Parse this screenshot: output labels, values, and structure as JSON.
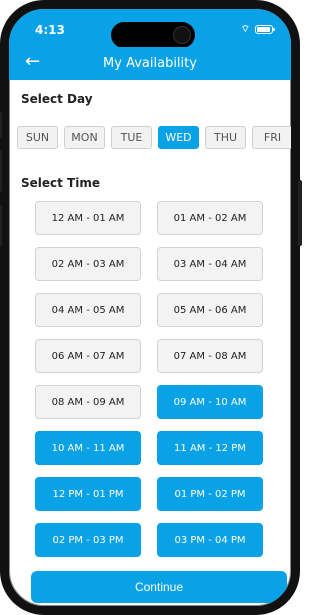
{
  "status": {
    "time": "4:13",
    "location_arrow": "➤",
    "wifi": "⌔"
  },
  "header": {
    "title": "My Availability",
    "back_icon": "←"
  },
  "select_day": {
    "label": "Select Day",
    "days": [
      {
        "label": "SUN"
      },
      {
        "label": "MON"
      },
      {
        "label": "TUE"
      },
      {
        "label": "WED"
      },
      {
        "label": "THU"
      },
      {
        "label": "FRI"
      }
    ]
  },
  "select_time": {
    "label": "Select Time",
    "slots": [
      {
        "label": "12 AM - 01 AM"
      },
      {
        "label": "01 AM - 02 AM"
      },
      {
        "label": "02 AM - 03 AM"
      },
      {
        "label": "03 AM - 04 AM"
      },
      {
        "label": "04 AM - 05 AM"
      },
      {
        "label": "05 AM - 06 AM"
      },
      {
        "label": "06 AM - 07 AM"
      },
      {
        "label": "07 AM - 08 AM"
      },
      {
        "label": "08 AM - 09 AM"
      },
      {
        "label": "09 AM - 10 AM"
      },
      {
        "label": "10 AM - 11 AM"
      },
      {
        "label": "11 AM - 12 PM"
      },
      {
        "label": "12 PM - 01 PM"
      },
      {
        "label": "01 PM - 02 PM"
      },
      {
        "label": "02 PM - 03 PM"
      },
      {
        "label": "03 PM - 04 PM"
      }
    ]
  },
  "continue_label": "Continue",
  "colors": {
    "accent": "#0aa2e6"
  }
}
